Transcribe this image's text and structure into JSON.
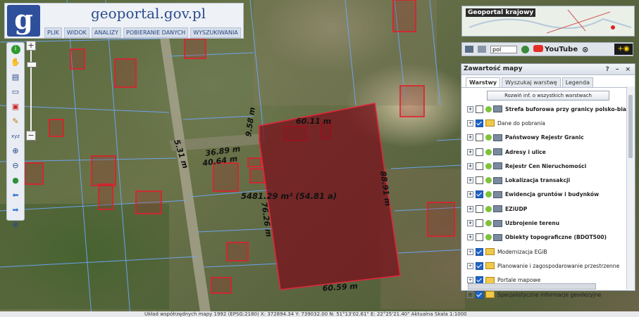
{
  "header": {
    "logo_letter": "g",
    "site_name": "geoportal.gov.pl",
    "menu": [
      "PLIK",
      "WIDOK",
      "ANALIZY",
      "POBIERANIE DANYCH",
      "WYSZUKIWANIA"
    ]
  },
  "top_right": {
    "krajowy_title": "Geoportal krajowy",
    "language": "pol",
    "youtube_label": "YouTube"
  },
  "panel": {
    "title": "Zawartość mapy",
    "controls": "? – ×",
    "tabs": [
      "Warstwy",
      "Wyszukaj warstwę",
      "Legenda"
    ],
    "active_tab": "Warstwy",
    "info_button": "Rozwiń inf. o wszystkich warstwach",
    "layers": [
      {
        "label": "Strefa buforowa przy granicy polsko-białoruskiej",
        "checked": false,
        "type": "service",
        "bold": true
      },
      {
        "label": "Dane do pobrania",
        "checked": true,
        "type": "folder",
        "bold": false
      },
      {
        "label": "Państwowy Rejestr Granic",
        "checked": false,
        "type": "service",
        "bold": true
      },
      {
        "label": "Adresy i ulice",
        "checked": false,
        "type": "service",
        "bold": true
      },
      {
        "label": "Rejestr Cen Nieruchomości",
        "checked": false,
        "type": "service",
        "bold": true
      },
      {
        "label": "Lokalizacja transakcji",
        "checked": false,
        "type": "service",
        "bold": true
      },
      {
        "label": "Ewidencja gruntów i budynków",
        "checked": true,
        "type": "service",
        "bold": true
      },
      {
        "label": "EZiUDP",
        "checked": false,
        "type": "service",
        "bold": true
      },
      {
        "label": "Uzbrojenie terenu",
        "checked": false,
        "type": "service",
        "bold": true
      },
      {
        "label": "Obiekty topograficzne (BDOT500)",
        "checked": false,
        "type": "service",
        "bold": true
      },
      {
        "label": "Modernizacja EGiB",
        "checked": true,
        "type": "folder",
        "bold": false
      },
      {
        "label": "Planowanie i zagospodarowanie przestrzenne",
        "checked": true,
        "type": "folder",
        "bold": false
      },
      {
        "label": "Portale mapowe",
        "checked": true,
        "type": "folder",
        "bold": false
      },
      {
        "label": "Specjalistyczne informacje geodezyjne",
        "checked": true,
        "type": "folder",
        "bold": false
      }
    ]
  },
  "measurements": {
    "top": "60.11 m",
    "left_short": "9.58 m",
    "right": "88.91 m",
    "bottom": "60.59 m",
    "left_long": "76.26 m",
    "diag_a": "36.89 m",
    "diag_b": "40.64 m",
    "small": "5.31 m",
    "area": "5481.29 m² (54.81 a)"
  },
  "tools": [
    "info-icon",
    "hand-icon",
    "layers-icon",
    "select-icon",
    "eraser-icon",
    "pencil-icon",
    "xyz-icon",
    "zoom-in-icon",
    "zoom-out-icon",
    "globe-icon",
    "back-icon",
    "forward-icon",
    "target-icon"
  ],
  "tool_glyphs": [
    "i",
    "✋",
    "▤",
    "▭",
    "▣",
    "✎",
    "xyz",
    "⊕",
    "⊖",
    "●",
    "⬅",
    "➡",
    "⊗"
  ],
  "zoom": {
    "plus": "+",
    "minus": "−"
  },
  "status": "Układ współrzędnych mapy 1992 (EPSG:2180)   X: 372894.34 Y: 739032.00   N: 51°13'02.61\" E: 22°25'21.40\"   Aktualna Skala 1:1000",
  "colors": {
    "parcel_fill": "#7a0d1a",
    "parcel_border": "#e0263a",
    "boundary_lines": "#6fa8ff",
    "building_outline": "#e41c2c"
  }
}
